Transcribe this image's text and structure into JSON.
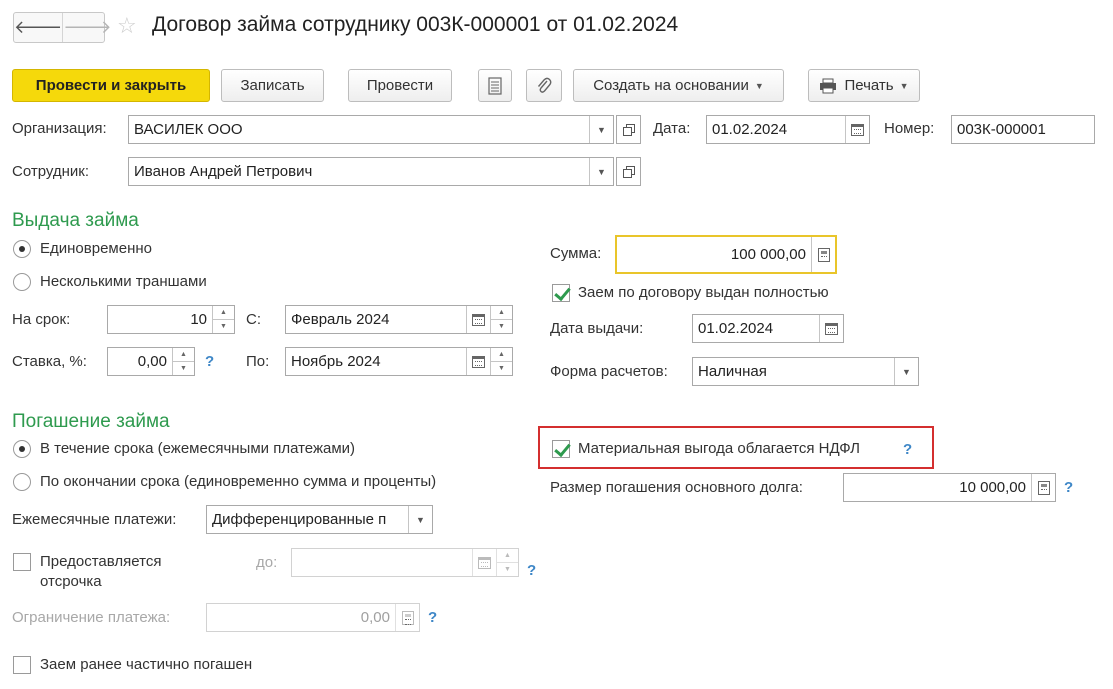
{
  "title": "Договор займа сотруднику 003К-000001 от 01.02.2024",
  "nav": {
    "back": "🡐",
    "forward": "🡒",
    "favorite": "☆"
  },
  "toolbar": {
    "post_close": "Провести и закрыть",
    "save": "Записать",
    "post": "Провести",
    "create_based": "Создать на основании",
    "print": "Печать"
  },
  "header": {
    "org_label": "Организация:",
    "org_value": "ВАСИЛЕК ООО",
    "date_label": "Дата:",
    "date_value": "01.02.2024",
    "number_label": "Номер:",
    "number_value": "003К-000001",
    "employee_label": "Сотрудник:",
    "employee_value": "Иванов Андрей Петрович"
  },
  "issue": {
    "section": "Выдача займа",
    "one_time": "Единовременно",
    "tranches": "Несколькими траншами",
    "term_label": "На срок:",
    "term_value": "10",
    "from_label": "С:",
    "from_value": "Февраль 2024",
    "rate_label": "Ставка, %:",
    "rate_value": "0,00",
    "to_label": "По:",
    "to_value": "Ноябрь 2024",
    "sum_label": "Сумма:",
    "sum_value": "100 000,00",
    "fully_issued": "Заем по договору выдан полностью",
    "issue_date_label": "Дата выдачи:",
    "issue_date_value": "01.02.2024",
    "payment_form_label": "Форма расчетов:",
    "payment_form_value": "Наличная"
  },
  "repay": {
    "section": "Погашение займа",
    "monthly": "В течение срока (ежемесячными платежами)",
    "at_end": "По окончании срока (единовременно сумма и проценты)",
    "monthly_payments_label": "Ежемесячные платежи:",
    "monthly_payments_value": "Дифференцированные п",
    "deferral_line1": "Предоставляется",
    "deferral_line2": "отсрочка",
    "until_label": "до:",
    "until_value": "",
    "limit_label": "Ограничение платежа:",
    "limit_value": "0,00",
    "partially_repaid": "Заем ранее частично погашен",
    "ndfl": "Материальная выгода облагается НДФЛ",
    "principal_label": "Размер погашения основного долга:",
    "principal_value": "10 000,00"
  },
  "help": "?",
  "colors": {
    "primary_button": "#f5d90b",
    "section": "#2e9a4e",
    "highlight": "#d42f2f",
    "focus": "#e9c52a",
    "help": "#3e87c7"
  }
}
